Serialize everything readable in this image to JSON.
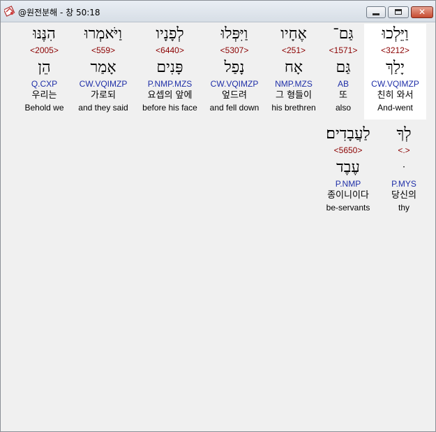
{
  "window": {
    "title": "@원전분해 - 창 50:18",
    "app_icon": "app-icon",
    "close_glyph": "✕"
  },
  "words": [
    {
      "hebrew": "וַיֵּלְכוּ",
      "strong": "<3212>",
      "lemma": "יָלַךְ",
      "morph": "CW.VQIMZP",
      "korean": "친히 와서",
      "english": "And-went"
    },
    {
      "hebrew": "גַּם־",
      "strong": "<1571>",
      "lemma": "גַּם",
      "morph": "AB",
      "korean": "또",
      "english": "also"
    },
    {
      "hebrew": "אֶחָיו",
      "strong": "<251>",
      "lemma": "אָח",
      "morph": "NMP.MZS",
      "korean": "그 형들이",
      "english": "his brethren"
    },
    {
      "hebrew": "וַיִּפְּלוּ",
      "strong": "<5307>",
      "lemma": "נָפַל",
      "morph": "CW.VQIMZP",
      "korean": "엎드려",
      "english": "and fell down"
    },
    {
      "hebrew": "לְפָנָיו",
      "strong": "<6440>",
      "lemma": "פָּנִים",
      "morph": "P.NMP.MZS",
      "korean": "요셉의 앞에",
      "english": "before his face"
    },
    {
      "hebrew": "וַיֹּאמְרוּ",
      "strong": "<559>",
      "lemma": "אָמַר",
      "morph": "CW.VQIMZP",
      "korean": "가로되",
      "english": "and they said"
    },
    {
      "hebrew": "הִנֶּנּוּ",
      "strong": "<2005>",
      "lemma": "הֵן",
      "morph": "Q.CXP",
      "korean": "우리는",
      "english": "Behold we"
    },
    {
      "hebrew": "לְךָ",
      "strong": "<.>",
      "lemma": "ּ",
      "morph": "P.MYS",
      "korean": "당신의",
      "english": "thy"
    },
    {
      "hebrew": "לַעֲבָדִים׃",
      "strong": "<5650>",
      "lemma": "עֶבֶד",
      "morph": "P.NMP",
      "korean": "종이니이다",
      "english": "be-servants"
    }
  ]
}
